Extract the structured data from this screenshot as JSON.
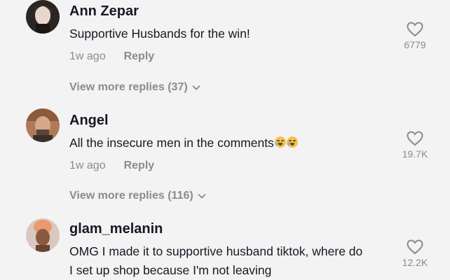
{
  "comments": [
    {
      "username": "Ann Zepar",
      "text": "Supportive Husbands for the win!",
      "time": "1w ago",
      "reply_label": "Reply",
      "likes": "6779",
      "more_replies": "View more replies (37)"
    },
    {
      "username": "Angel",
      "text": "All the insecure men in the comments",
      "time": "1w ago",
      "reply_label": "Reply",
      "likes": "19.7K",
      "more_replies": "View more replies (116)"
    },
    {
      "username": "glam_melanin",
      "text_line1": "OMG I made it to supportive husband tiktok, where do",
      "text_line2": "I set up shop because I'm not leaving",
      "likes": "12.2K"
    }
  ]
}
